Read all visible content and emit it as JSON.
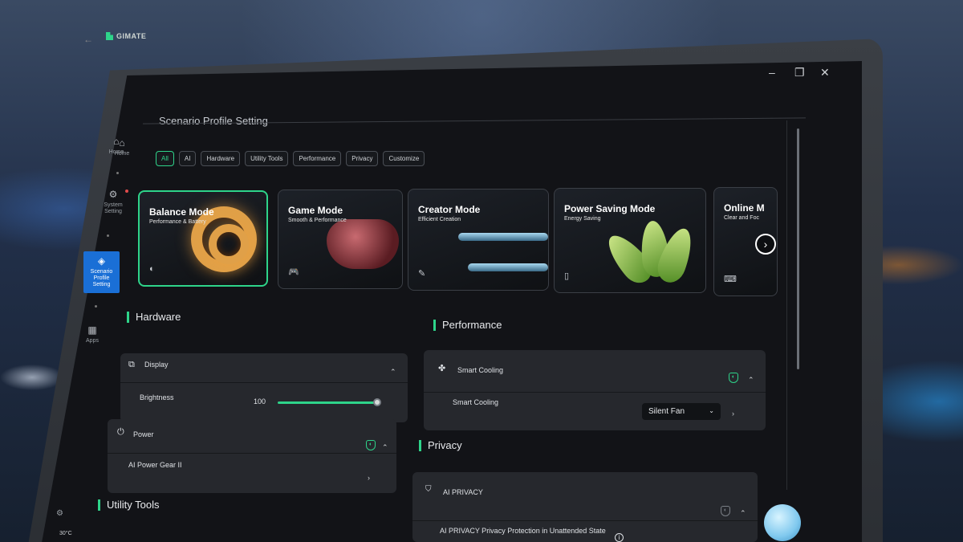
{
  "app": {
    "brand": "GIMATE",
    "page_title": "Scenario Profile Setting"
  },
  "window_controls": {
    "minimize": "–",
    "maximize": "❐",
    "close": "✕"
  },
  "sidebar": {
    "items": [
      {
        "label": "Home",
        "icon": "home-icon",
        "glyph": "⌂"
      },
      {
        "label": "System Setting",
        "icon": "gear-icon",
        "glyph": "⚙"
      },
      {
        "label": "Scenario Profile Setting",
        "icon": "profile-icon",
        "glyph": "◈",
        "active": true
      },
      {
        "label": "Apps",
        "icon": "apps-icon",
        "glyph": "▦"
      }
    ]
  },
  "filters": [
    "All",
    "AI",
    "Hardware",
    "Utility Tools",
    "Performance",
    "Privacy",
    "Customize"
  ],
  "modes": [
    {
      "title": "Balance Mode",
      "subtitle": "Performance & Battery",
      "icon": "balance-icon",
      "glyph": "◐",
      "active": true
    },
    {
      "title": "Game Mode",
      "subtitle": "Smooth & Performance",
      "icon": "gamepad-icon",
      "glyph": "🎮"
    },
    {
      "title": "Creator Mode",
      "subtitle": "Efficient Creation",
      "icon": "pen-icon",
      "glyph": "✎"
    },
    {
      "title": "Power Saving Mode",
      "subtitle": "Energy Saving",
      "icon": "battery-leaf-icon",
      "glyph": "▯"
    },
    {
      "title": "Online M",
      "subtitle": "Clear and Foc",
      "icon": "online-meeting-icon",
      "glyph": "⌨"
    }
  ],
  "next_glyph": "›",
  "hardware": {
    "title": "Hardware",
    "display": {
      "label": "Display",
      "brightness_label": "Brightness",
      "brightness_value": "100",
      "brightness_fraction": 1.0
    },
    "power": {
      "label": "Power",
      "gear_label": "AI Power Gear II"
    }
  },
  "utility": {
    "title": "Utility Tools"
  },
  "performance": {
    "title": "Performance",
    "cooling": {
      "label": "Smart Cooling",
      "row_label": "Smart Cooling",
      "selected": "Silent Fan"
    }
  },
  "privacy": {
    "title": "Privacy",
    "ai_privacy": {
      "label": "AI PRIVACY",
      "row_label": "AI PRIVACY Privacy Protection in Unattended State"
    }
  },
  "taskbar": {
    "temperature": "30°C"
  },
  "colors": {
    "accent": "#2ed48a",
    "sidebar_active": "#1a6fd6"
  }
}
